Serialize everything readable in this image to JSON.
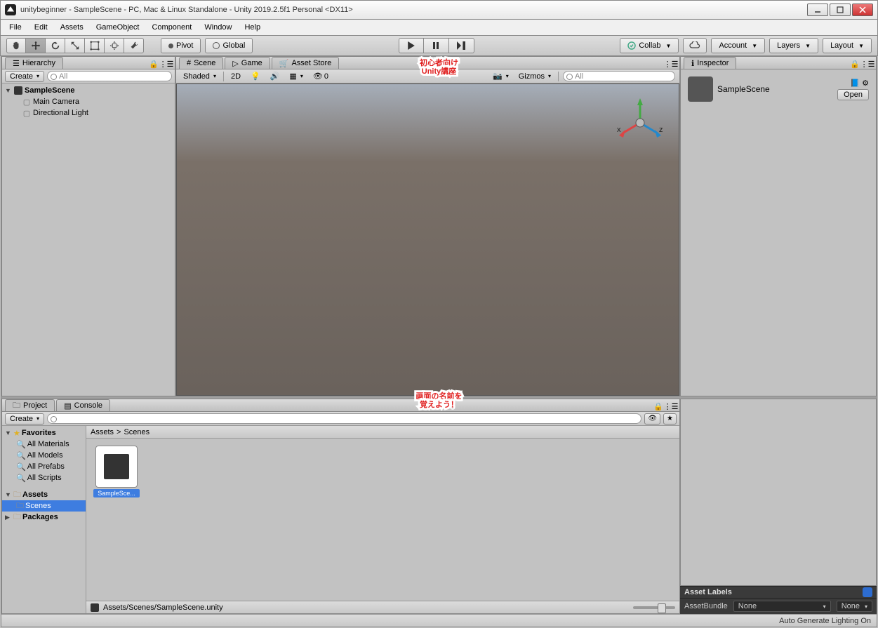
{
  "window": {
    "title": "unitybeginner - SampleScene - PC, Mac & Linux Standalone - Unity 2019.2.5f1 Personal <DX11>"
  },
  "menu": {
    "file": "File",
    "edit": "Edit",
    "assets": "Assets",
    "gameobject": "GameObject",
    "component": "Component",
    "window": "Window",
    "help": "Help"
  },
  "toolbar": {
    "pivot": "Pivot",
    "global": "Global",
    "collab": "Collab",
    "account": "Account",
    "layers": "Layers",
    "layout": "Layout"
  },
  "hierarchy": {
    "tab": "Hierarchy",
    "create": "Create",
    "search_placeholder": "All",
    "scene": "SampleScene",
    "items": [
      "Main Camera",
      "Directional Light"
    ]
  },
  "scene_tabs": {
    "scene": "Scene",
    "game": "Game",
    "asset_store": "Asset Store"
  },
  "scene_toolbar": {
    "shaded": "Shaded",
    "two_d": "2D",
    "gizmos": "Gizmos",
    "search_placeholder": "All",
    "audio_value": "0"
  },
  "inspector": {
    "tab": "Inspector",
    "name": "SampleScene",
    "open": "Open"
  },
  "project": {
    "tab": "Project",
    "console": "Console",
    "create": "Create",
    "search_placeholder": "",
    "favorites": "Favorites",
    "fav_items": [
      "All Materials",
      "All Models",
      "All Prefabs",
      "All Scripts"
    ],
    "assets": "Assets",
    "scenes": "Scenes",
    "packages": "Packages",
    "breadcrumb_root": "Assets",
    "breadcrumb_sep": ">",
    "breadcrumb_current": "Scenes",
    "asset_item": "SampleSce...",
    "footer_path": "Assets/Scenes/SampleScene.unity"
  },
  "asset_labels": {
    "header": "Asset Labels",
    "bundle": "AssetBundle",
    "none": "None"
  },
  "statusbar": {
    "text": "Auto Generate Lighting On"
  },
  "overlay": {
    "line1": "初心者向け",
    "line2": "Unity講座",
    "line3": "画面の名前を",
    "line4": "覚えよう！"
  },
  "gizmo": {
    "x": "x",
    "z": "z"
  }
}
